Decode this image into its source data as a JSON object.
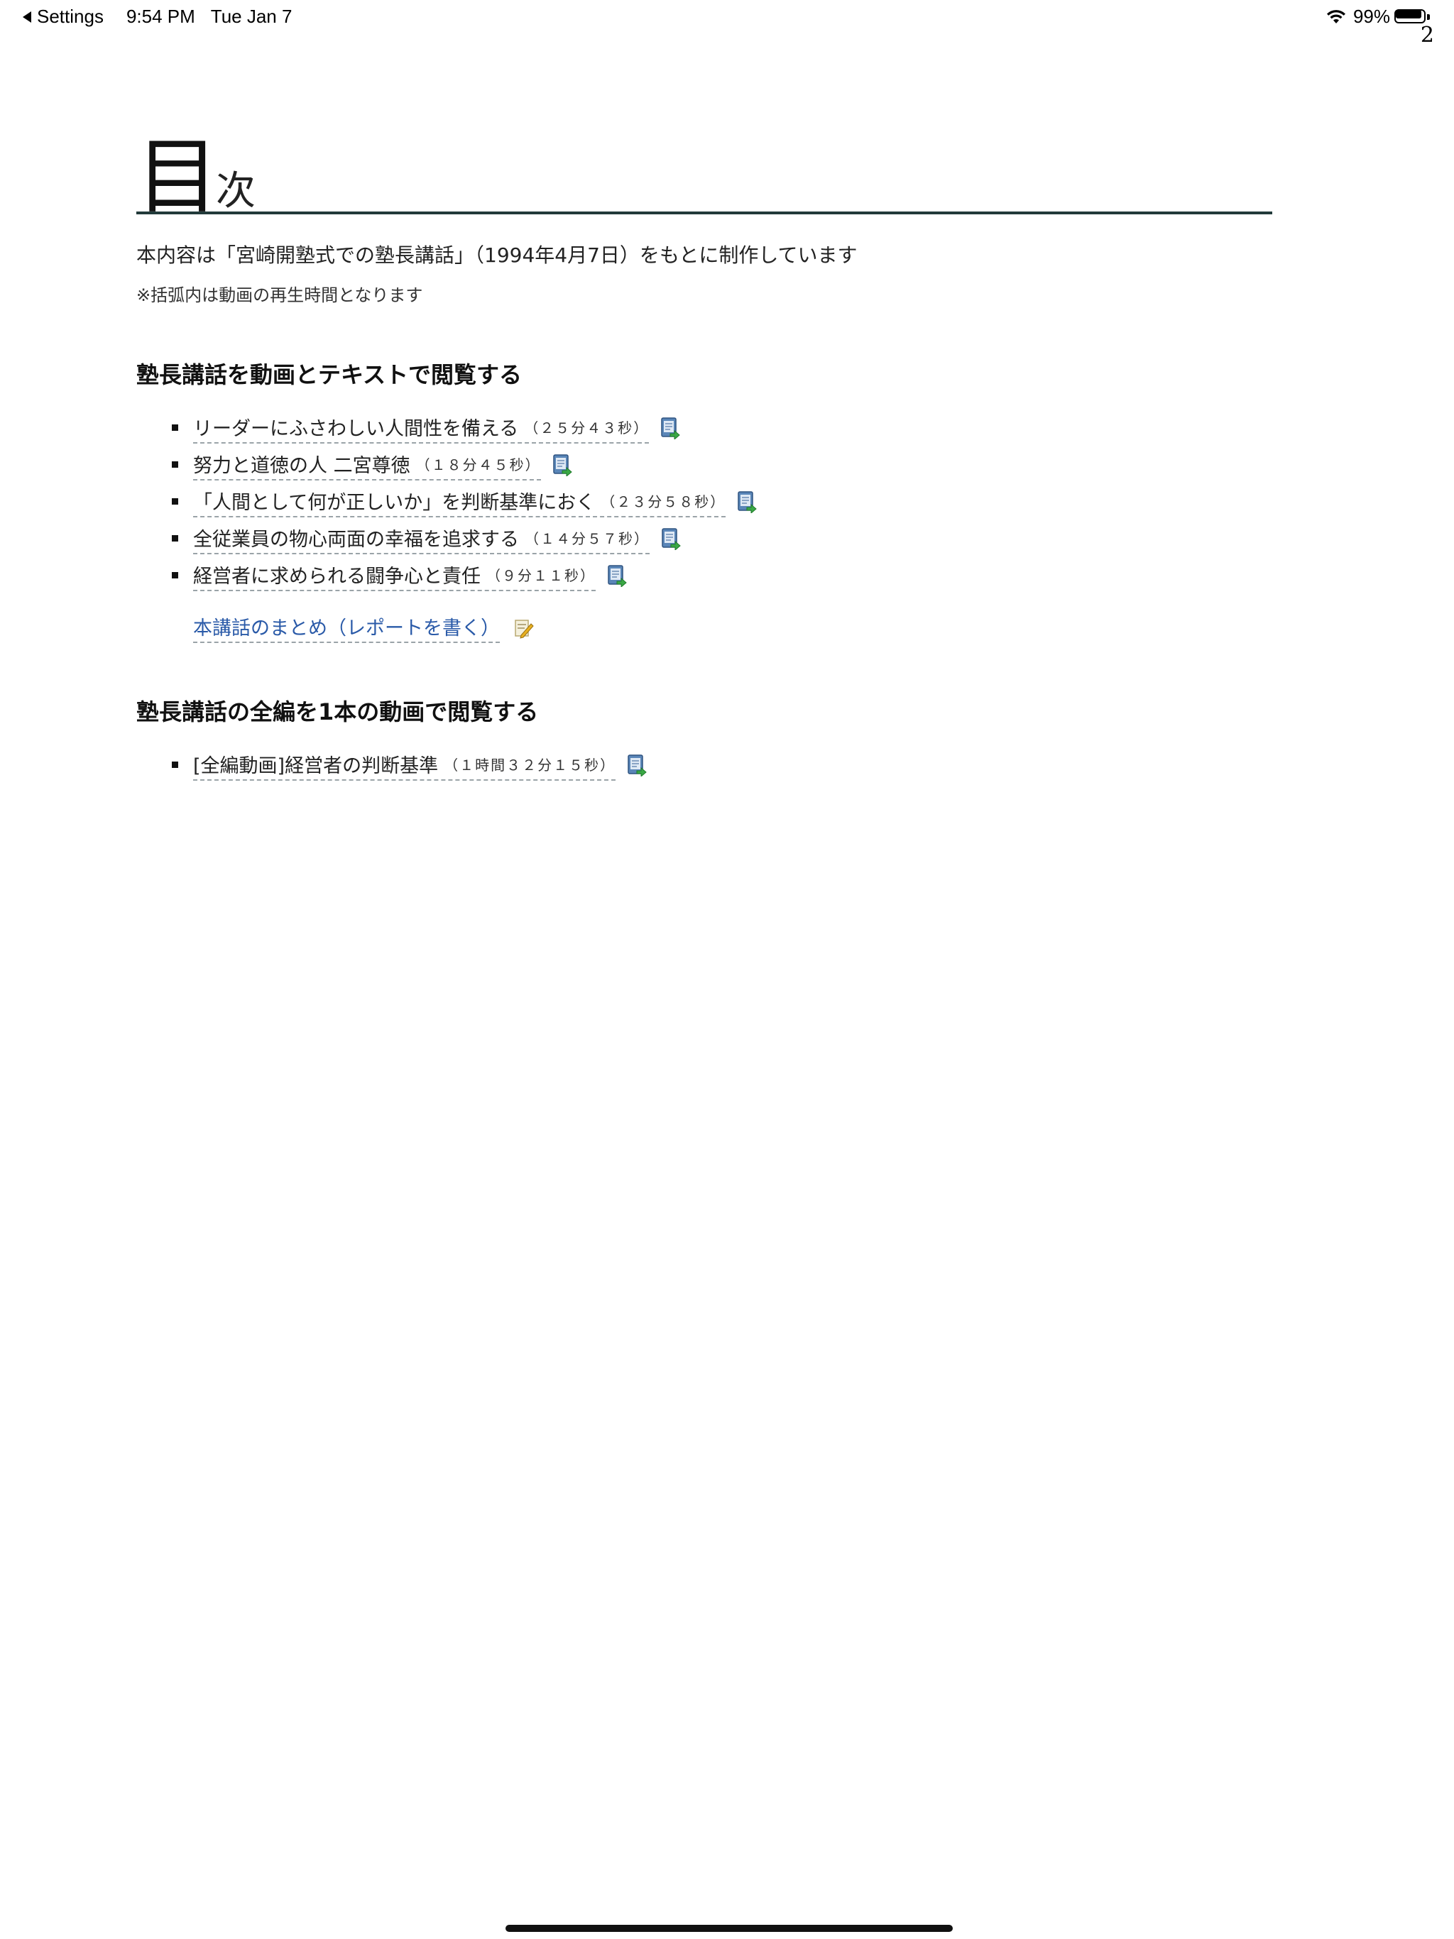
{
  "status_bar": {
    "back_label": "Settings",
    "time": "9:54 PM",
    "date": "Tue Jan 7",
    "battery": "99%",
    "battery_level": 0.99
  },
  "page_number": "2",
  "title": {
    "big": "目",
    "small": "次"
  },
  "intro": "本内容は「宮崎開塾式での塾長講話」（1994年4月7日）をもとに制作しています",
  "note": "※括弧内は動画の再生時間となります",
  "section1": {
    "heading": "塾長講話を動画とテキストで閲覧する",
    "items": [
      {
        "title": "リーダーにふさわしい人間性を備える",
        "duration": "（２５分４３秒）",
        "icon": "document-icon"
      },
      {
        "title": "努力と道徳の人 二宮尊徳",
        "duration": "（１８分４５秒）",
        "icon": "document-icon"
      },
      {
        "title": "「人間として何が正しいか」を判断基準におく",
        "duration": "（２３分５８秒）",
        "icon": "document-icon"
      },
      {
        "title": "全従業員の物心両面の幸福を追求する",
        "duration": "（１４分５７秒）",
        "icon": "document-icon"
      },
      {
        "title": "経営者に求められる闘争心と責任",
        "duration": "（９分１１秒）",
        "icon": "document-icon"
      }
    ],
    "summary_link": "本講話のまとめ（レポートを書く）",
    "summary_icon": "pencil-icon"
  },
  "section2": {
    "heading": "塾長講話の全編を1本の動画で閲覧する",
    "items": [
      {
        "title": "[全編動画]経営者の判断基準",
        "duration": "（１時間３２分１５秒）",
        "icon": "document-icon"
      }
    ]
  },
  "colors": {
    "link_blue": "#2a5aa8",
    "title_rule": "#223a3a",
    "icon_blue": "#5a86b8",
    "icon_green": "#3aa845"
  }
}
